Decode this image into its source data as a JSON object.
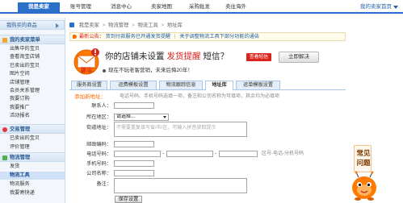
{
  "top_nav": {
    "tabs": [
      {
        "label": "我是卖家",
        "active": true
      },
      {
        "label": "账号管理",
        "active": false
      },
      {
        "label": "消息中心",
        "active": false
      },
      {
        "label": "卖家地图",
        "active": false
      },
      {
        "label": "采购批发",
        "active": false
      },
      {
        "label": "卖往海外",
        "active": false
      }
    ],
    "right_link": "我的卖家首页",
    "right_icon": "chevron-down-icon"
  },
  "sidebar": {
    "top_item": {
      "label": "我购买的商品",
      "icon": "arrow-right-icon"
    },
    "sections": [
      {
        "title": "我的卖家菜单",
        "icon": "seller-menu-icon",
        "items": [
          "出售中的宝贝",
          "查看淘宝店铺",
          "已卖出的宝贝",
          "图片空间",
          "店铺管理",
          "会员关系管理",
          "我要订购",
          "我要推广",
          "活动报名"
        ]
      },
      {
        "title": "交易管理",
        "icon": "trade-icon",
        "items": [
          "已卖出的宝贝",
          "评价管理"
        ]
      },
      {
        "title": "物流管理",
        "icon": "logistics-icon",
        "items": [
          "发货",
          "物流工具",
          "物流服务",
          "我要寄快递"
        ],
        "active_item_index": 1
      }
    ]
  },
  "breadcrumb": {
    "icon": "home-icon",
    "items": [
      "我是卖家",
      "物流管理",
      "物流工具",
      "地址库"
    ],
    "separator": ">"
  },
  "notice": {
    "icon": "speaker-icon",
    "label": "最新公告：",
    "links": [
      "货到付款服务已开通发货提醒",
      "关于调整物流工具下部分功能的通告"
    ],
    "separator": "|"
  },
  "promo": {
    "mascot_icon": "mascot-envelope-icon",
    "headline_prefix": "你的店铺未设置",
    "headline_highlight": "发货提醒",
    "headline_suffix": "短信？",
    "view_button": "查看短信",
    "action_button": "立即解决",
    "tip_label": "提示：",
    "tip_text": "现在不玩老客营销，未来后悔20年！"
  },
  "tabs": [
    {
      "label": "服务商设置",
      "active": false
    },
    {
      "label": "运费模板设置",
      "active": false
    },
    {
      "label": "物流跟踪信息",
      "active": false
    },
    {
      "label": "地址库",
      "active": true
    },
    {
      "label": "运单模板设置",
      "active": false
    }
  ],
  "form": {
    "title": "添加新地址：",
    "hint": "电话号码、手机号码选填一项，备注和公司名称为可填项，其余均为必填项",
    "fields": {
      "contact": {
        "label": "联系人："
      },
      "region": {
        "label": "所在地区：",
        "selected": "请选择..."
      },
      "street": {
        "label": "街道地址：",
        "placeholder": "不需要重复填写省/市/区，可输入拼音获取提示"
      },
      "postcode": {
        "label": "邮政编码："
      },
      "phone": {
        "label": "电话号码：",
        "separator": "-",
        "hint": "区号-电话-分机号码"
      },
      "mobile": {
        "label": "手机号码："
      },
      "company": {
        "label": "公司名称："
      },
      "remark": {
        "label": "备注："
      }
    },
    "save_button": "保存设置"
  },
  "faq": {
    "label": "常见问题",
    "icon": "mascot-icon"
  },
  "colors": {
    "brand_blue": "#2a6fc9",
    "accent_orange": "#ff6600",
    "alert_red": "#d9251c",
    "link_blue": "#1f5fa8",
    "tab_bg": "#e4eef9",
    "sidebar_bg": "#f3f7fc"
  }
}
